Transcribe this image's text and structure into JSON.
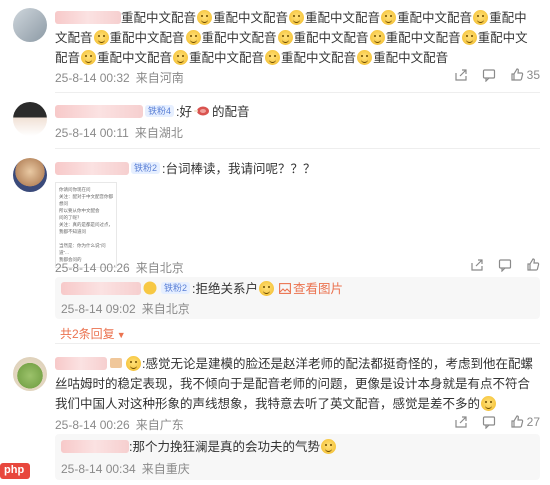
{
  "comments": [
    {
      "text_prefix": "",
      "phrase": "重配中文配音",
      "repeat": 14,
      "time": "25-8-14 00:32",
      "location": "来自河南",
      "likes": "35"
    },
    {
      "badge": "铁粉4",
      "text": ":好",
      "text2": "的配音",
      "time": "25-8-14 00:11",
      "location": "来自湖北"
    },
    {
      "badge": "铁粉2",
      "text": ":台词棒读，我请问呢？？？",
      "time": "25-8-14 00:26",
      "location": "来自北京",
      "thumb_lines": [
        "你请问你现在问",
        "关注：配对于中文配音你都想问",
        "所以要从你中文配会",
        "问的了呢？",
        "关注：真的是都是问过点，",
        "我都不知道问",
        "",
        "当然是：你为什么说\"问道\"...",
        "我都会问的"
      ],
      "reply": {
        "badge": "铁粉2",
        "text": ":拒绝关系户",
        "view_image": "查看图片",
        "time": "25-8-14 09:02",
        "location": "来自北京"
      },
      "more_replies": "共2条回复"
    },
    {
      "text": ":感觉无论是建模的脸还是赵洋老师的配法都挺奇怪的，考虑到他在配螺丝咕姆时的稳定表现，我不倾向于是配音老师的问题，更像是设计本身就是有点不符合我们中国人对这种形象的声线想象，我特意去听了英文配音，感觉是差不多的",
      "time": "25-8-14 00:26",
      "location": "来自广东",
      "likes": "27",
      "reply": {
        "text": ":那个力挽狂澜是真的会功夫的气势",
        "time": "25-8-14 00:34",
        "location": "来自重庆"
      }
    }
  ],
  "watermark": "php"
}
